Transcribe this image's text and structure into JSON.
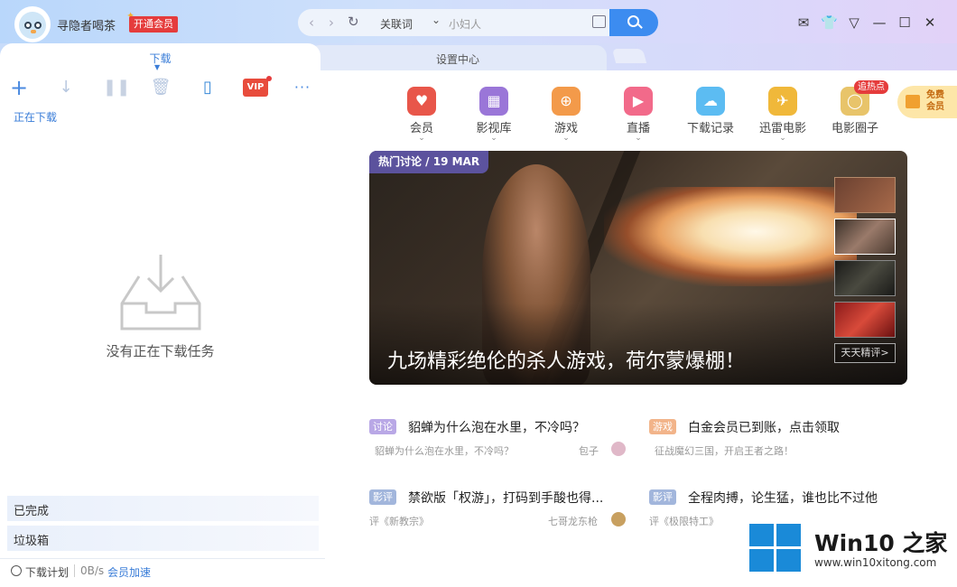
{
  "titlebar": {
    "username": "寻隐者喝茶",
    "vip_button": "开通会员",
    "search_keyword_type": "关联词",
    "search_placeholder": "小妇人"
  },
  "tabs": [
    {
      "label": "下载"
    },
    {
      "label": "设置中心"
    }
  ],
  "left": {
    "toolbar_vip": "VIP",
    "toolbar_more": "···",
    "downloading_label": "正在下载",
    "empty_message": "没有正在下载任务",
    "list": [
      {
        "label": "已完成"
      },
      {
        "label": "垃圾箱"
      }
    ],
    "status": {
      "plan": "下载计划",
      "speed": "0B/s",
      "accelerate": "会员加速"
    }
  },
  "nav": [
    {
      "label": "会员"
    },
    {
      "label": "影视库"
    },
    {
      "label": "游戏"
    },
    {
      "label": "直播"
    },
    {
      "label": "下载记录"
    },
    {
      "label": "迅雷电影"
    },
    {
      "label": "电影圈子"
    }
  ],
  "hot_badge": "追热点",
  "free_vip": "免费会员",
  "hero": {
    "tag": "热门讨论 / 19 MAR",
    "title": "九场精彩绝伦的杀人游戏，荷尔蒙爆棚！",
    "daily_button": "天天精评>"
  },
  "articles": [
    {
      "badge": "讨论",
      "title": "貂蝉为什么泡在水里，不冷吗？",
      "sub": "貂蝉为什么泡在水里，不冷吗？",
      "author": "包子"
    },
    {
      "badge": "游戏",
      "title": "白金会员已到账，点击领取",
      "sub": "征战魔幻三国，开启王者之路！",
      "author": ""
    },
    {
      "badge": "影评",
      "title": "禁欲版「权游」，打码到手酸也得...",
      "sub": "评《新教宗》",
      "author": "七哥龙东枪"
    },
    {
      "badge": "影评",
      "title": "全程肉搏，论生猛，谁也比不过他",
      "sub": "评《极限特工》",
      "author": ""
    }
  ],
  "watermark": {
    "brand": "Win10 之家",
    "site": "www.win10xitong.com"
  },
  "colors": {
    "accent": "#3c8cf0",
    "vip_red": "#e53c3c",
    "link_blue": "#3a7dd8"
  }
}
